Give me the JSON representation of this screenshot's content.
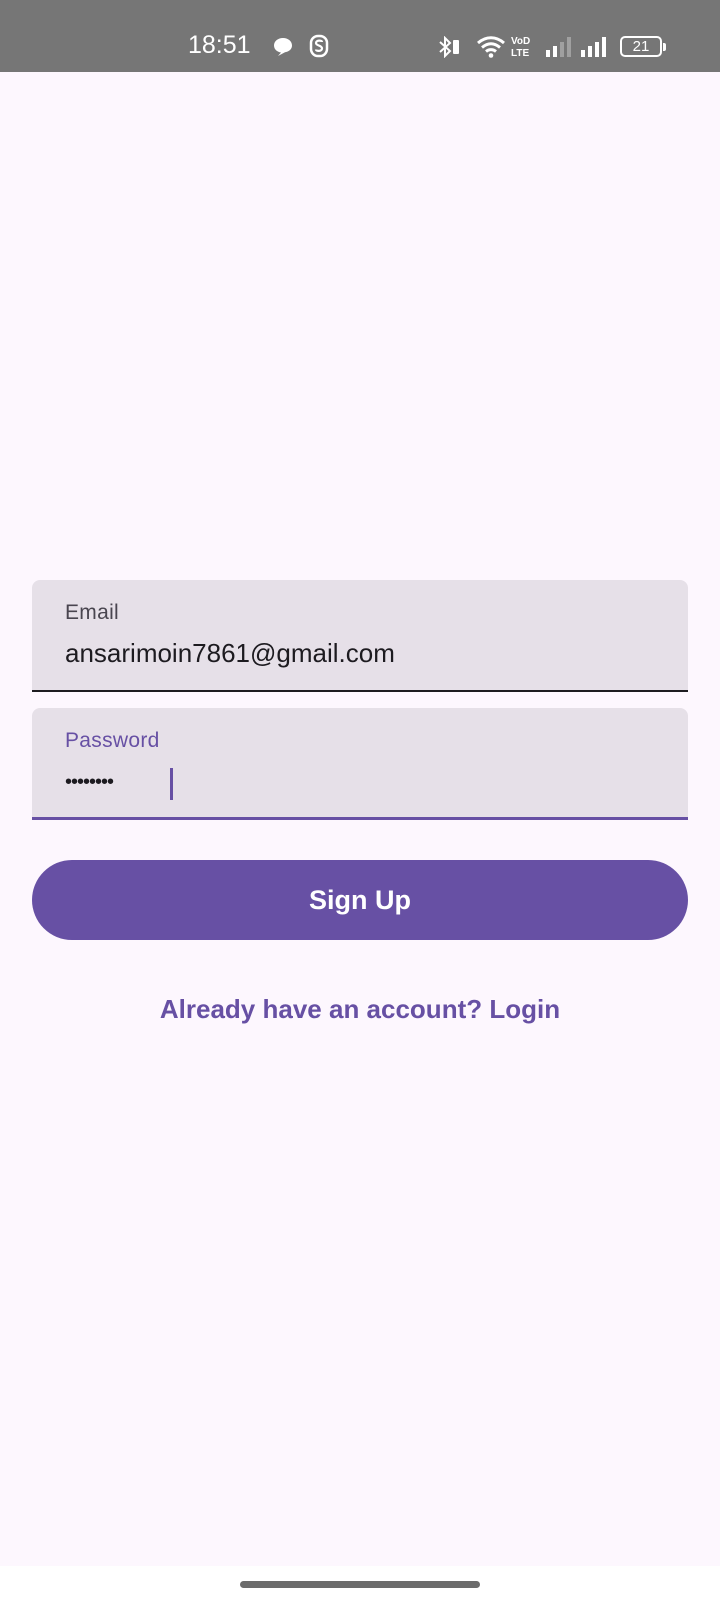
{
  "status_bar": {
    "time": "18:51",
    "battery": "21",
    "icons": [
      "message-bubble-icon",
      "s-app-icon",
      "bluetooth-icon",
      "wifi-icon",
      "volte-icon",
      "signal-icon",
      "signal-icon",
      "battery-icon"
    ]
  },
  "form": {
    "email": {
      "label": "Email",
      "value": "ansarimoin7861@gmail.com"
    },
    "password": {
      "label": "Password",
      "value_masked": "••••••••"
    },
    "signup_label": "Sign Up",
    "login_link": "Already have an account? Login"
  },
  "colors": {
    "background": "#fdf7fe",
    "accent": "#6750a4",
    "field_fill": "#e6e0e8",
    "status_bar": "#767676"
  }
}
